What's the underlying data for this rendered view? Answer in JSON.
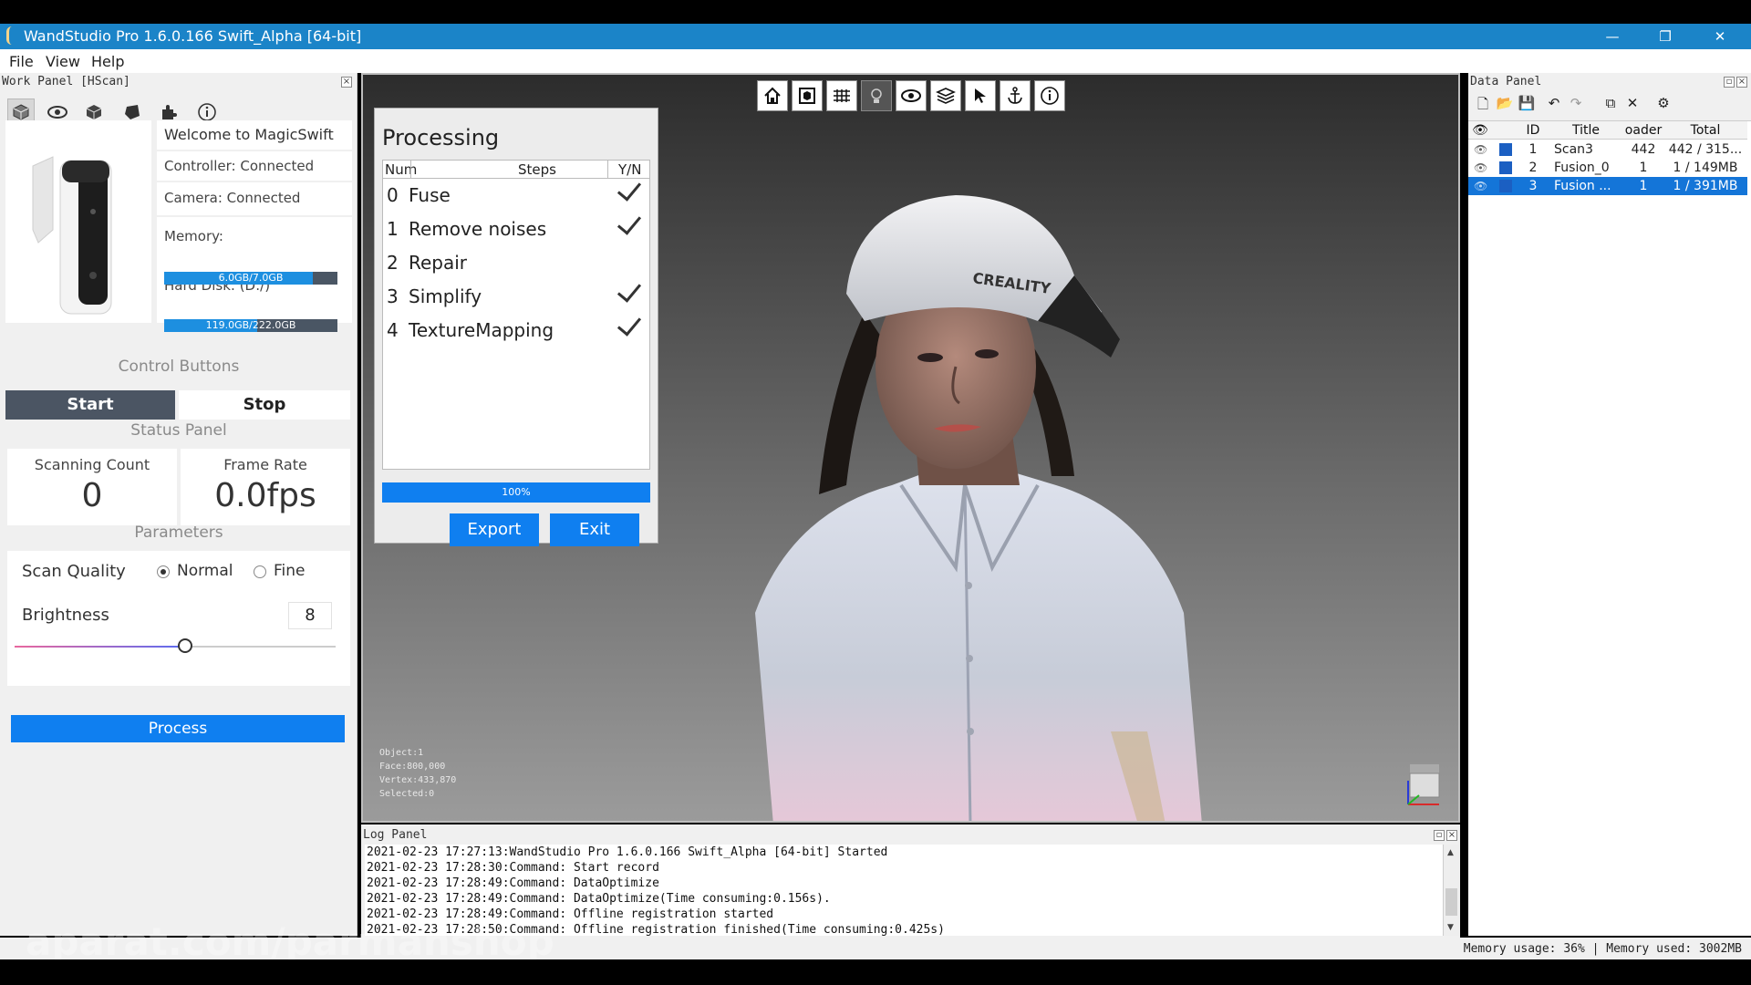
{
  "window": {
    "title": "WandStudio Pro 1.6.0.166 Swift_Alpha [64-bit]",
    "minimize": "—",
    "maximize": "❐",
    "close": "✕"
  },
  "menu": [
    "File",
    "View",
    "Help"
  ],
  "work_panel": {
    "header": "Work Panel [HScan]",
    "welcome": "Welcome to MagicSwift",
    "controller": "Controller: Connected",
    "camera": "Camera: Connected",
    "memory_label": "Memory:",
    "memory_value": "6.0GB/7.0GB",
    "memory_fraction": 0.857,
    "disk_label": "Hard Disk: (D:/)",
    "disk_value": "119.0GB/222.0GB",
    "disk_fraction": 0.536,
    "control_title": "Control Buttons",
    "start": "Start",
    "stop": "Stop",
    "status_title": "Status Panel",
    "scanning_count_label": "Scanning Count",
    "scanning_count": "0",
    "frame_rate_label": "Frame Rate",
    "frame_rate": "0.0fps",
    "parameters_title": "Parameters",
    "scan_quality_label": "Scan Quality",
    "quality_normal": "Normal",
    "quality_fine": "Fine",
    "brightness_label": "Brightness",
    "brightness_value": "8",
    "brightness_fraction": 0.53,
    "process": "Process"
  },
  "processing": {
    "title": "Processing",
    "col_num": "Num",
    "col_steps": "Steps",
    "col_yn": "Y/N",
    "steps": [
      {
        "num": "0",
        "name": "Fuse",
        "done": true
      },
      {
        "num": "1",
        "name": "Remove noises",
        "done": true
      },
      {
        "num": "2",
        "name": "Repair",
        "done": false
      },
      {
        "num": "3",
        "name": "Simplify",
        "done": true
      },
      {
        "num": "4",
        "name": "TextureMapping",
        "done": true
      }
    ],
    "progress_label": "100%",
    "export": "Export",
    "exit": "Exit"
  },
  "viewport": {
    "cap_text": "CREALITY",
    "stats": [
      "Object:1",
      "Face:800,000",
      "Vertex:433,870",
      "Selected:0"
    ]
  },
  "log_panel": {
    "header": "Log Panel",
    "lines": [
      "2021-02-23 17:27:13:WandStudio Pro 1.6.0.166 Swift_Alpha [64-bit] Started",
      "2021-02-23 17:28:30:Command: Start record",
      "2021-02-23 17:28:49:Command: DataOptimize",
      "2021-02-23 17:28:49:Command: DataOptimize(Time consuming:0.156s).",
      "2021-02-23 17:28:49:Command: Offline registration started",
      "2021-02-23 17:28:50:Command: Offline registration finished(Time consuming:0.425s)"
    ]
  },
  "data_panel": {
    "header": "Data Panel",
    "columns": [
      "ID",
      "Title",
      "oader",
      "Total"
    ],
    "rows": [
      {
        "id": "1",
        "title": "Scan3",
        "loader": "442",
        "total": "442 / 315..."
      },
      {
        "id": "2",
        "title": "Fusion_0",
        "loader": "1",
        "total": "1 / 149MB"
      },
      {
        "id": "3",
        "title": "Fusion ...",
        "loader": "1",
        "total": "1 / 391MB"
      }
    ]
  },
  "status_bar": "Memory usage: 36% | Memory used: 3002MB",
  "watermark": "aparat.com/parmanshop"
}
